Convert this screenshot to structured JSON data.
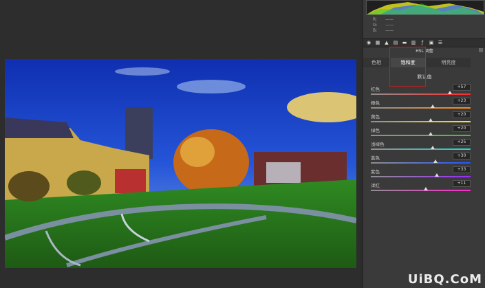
{
  "histogram": {
    "rgb": [
      {
        "label": "R:",
        "value": "——"
      },
      {
        "label": "G:",
        "value": "——"
      },
      {
        "label": "B:",
        "value": "——"
      }
    ]
  },
  "toolbar_icons": [
    "basic-panel-icon",
    "tone-curve-icon",
    "detail-icon",
    "hsl-icon",
    "split-tone-icon",
    "lens-icon",
    "fx-icon",
    "camera-calibration-icon",
    "presets-icon"
  ],
  "panel": {
    "title": "HSL 调整",
    "tabs": [
      {
        "label": "色相",
        "active": false
      },
      {
        "label": "饱和度",
        "active": true
      },
      {
        "label": "明亮度",
        "active": false
      }
    ],
    "default_label": "默认值",
    "sliders": [
      {
        "label": "红色",
        "value": "+57",
        "pos": 0.79,
        "gradient": [
          "#8f8f8f",
          "#ff2a2a"
        ]
      },
      {
        "label": "橙色",
        "value": "+23",
        "pos": 0.62,
        "gradient": [
          "#8f8f8f",
          "#ff8a1a"
        ]
      },
      {
        "label": "黄色",
        "value": "+20",
        "pos": 0.6,
        "gradient": [
          "#8f8f8f",
          "#ffe81a"
        ]
      },
      {
        "label": "绿色",
        "value": "+20",
        "pos": 0.6,
        "gradient": [
          "#8f8f8f",
          "#35d11f"
        ]
      },
      {
        "label": "浅绿色",
        "value": "+25",
        "pos": 0.62,
        "gradient": [
          "#8f8f8f",
          "#22d6c8"
        ]
      },
      {
        "label": "蓝色",
        "value": "+30",
        "pos": 0.65,
        "gradient": [
          "#8f8f8f",
          "#2255ff"
        ]
      },
      {
        "label": "紫色",
        "value": "+33",
        "pos": 0.66,
        "gradient": [
          "#8f8f8f",
          "#9a2cff"
        ]
      },
      {
        "label": "洋红",
        "value": "+11",
        "pos": 0.55,
        "gradient": [
          "#8f8f8f",
          "#ff2ad0"
        ]
      }
    ]
  },
  "watermark": "UiBQ.CoM"
}
